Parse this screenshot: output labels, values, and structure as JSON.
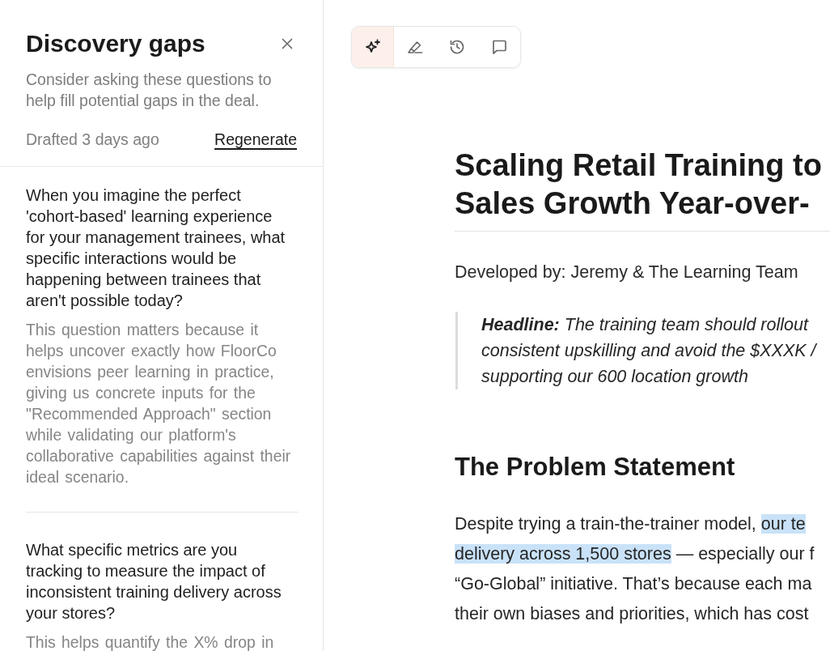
{
  "panel": {
    "title": "Discovery gaps",
    "subtitle": "Consider asking these questions to help fill potential gaps in the deal.",
    "drafted": "Drafted 3 days ago",
    "regenerate_link": "Regenerate"
  },
  "questions": [
    {
      "question": "When you imagine the perfect 'cohort-based' learning experience for your management trainees, what specific interactions would be happening between trainees that aren't possible today?",
      "explanation": "This question matters because it helps uncover exactly how FloorCo envisions peer learning in practice, giving us concrete inputs for the \"Recommended Approach\" section while validating our platform's collaborative capabilities against their ideal scenario."
    },
    {
      "question": "What specific metrics are you tracking to measure the impact of inconsistent training delivery across your stores?",
      "explanation": "This helps quantify the X% drop in"
    }
  ],
  "toolbar": {
    "tools": [
      {
        "kind": "sparkle",
        "selected": true
      },
      {
        "kind": "highlighter",
        "selected": false
      },
      {
        "kind": "history",
        "selected": false
      },
      {
        "kind": "comment",
        "selected": false
      }
    ]
  },
  "document": {
    "title_lines": [
      "Scaling Retail Training to",
      "Sales Growth Year-over-"
    ],
    "byline": "Developed by: Jeremy & The Learning Team",
    "headline_lines": [
      "**Headline:** The training team should rollout",
      "consistent upskilling and avoid the $XXXK /",
      "supporting our 600 location growth"
    ],
    "section_heading": "The Problem Statement",
    "paragraph_lines": [
      [
        {
          "text": "Despite trying a train-the-trainer model, ",
          "highlighted": false
        },
        {
          "text": "our te",
          "highlighted": true
        }
      ],
      [
        {
          "text": "delivery across 1,500 stores",
          "highlighted": true
        },
        {
          "text": " — especially our f",
          "highlighted": false
        }
      ],
      [
        {
          "text": "“Go-Global” initiative. That’s because each ma",
          "highlighted": false
        }
      ],
      [
        {
          "text": "their own biases and priorities, which has cost",
          "highlighted": false
        }
      ]
    ]
  }
}
